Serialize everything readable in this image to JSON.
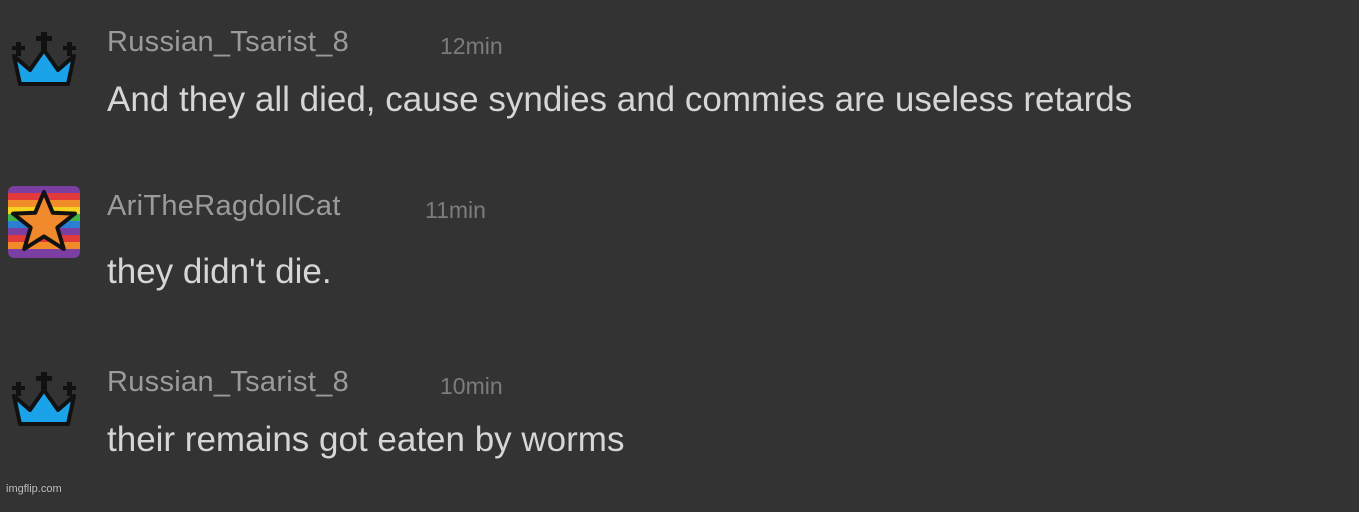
{
  "messages": [
    {
      "username": "Russian_Tsarist_8",
      "timestamp": "12min",
      "text": "And they all died, cause syndies and commies are useless retards",
      "avatar_icon": "crown-icon",
      "avatar_color": "#1aa3e8"
    },
    {
      "username": "AriTheRagdollCat",
      "timestamp": "11min",
      "text": "they didn't die.",
      "avatar_icon": "rainbow-star-icon",
      "avatar_color": "#f08a2c"
    },
    {
      "username": "Russian_Tsarist_8",
      "timestamp": "10min",
      "text": "their remains got eaten by worms",
      "avatar_icon": "crown-icon",
      "avatar_color": "#1aa3e8"
    }
  ],
  "watermark": "imgflip.com"
}
